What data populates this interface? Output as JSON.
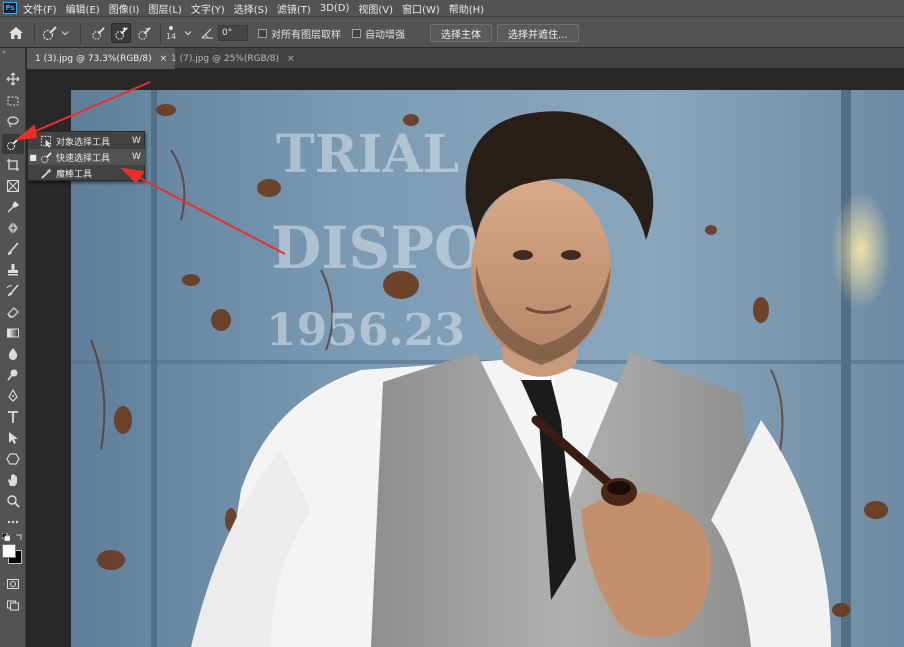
{
  "app": {
    "logo_text": "Ps"
  },
  "menu": [
    "文件(F)",
    "编辑(E)",
    "图像(I)",
    "图层(L)",
    "文字(Y)",
    "选择(S)",
    "滤镜(T)",
    "3D(D)",
    "视图(V)",
    "窗口(W)",
    "帮助(H)"
  ],
  "options": {
    "brush_size": "14",
    "angle_value": "0°",
    "sample_all_layers": "对所有图层取样",
    "auto_enhance": "自动增强",
    "select_subject": "选择主体",
    "select_and_mask": "选择并遮住..."
  },
  "tabs": [
    {
      "label": "1 (3).jpg @ 73.3%(RGB/8)",
      "close": "×"
    },
    {
      "label": "1 (7).jpg @ 25%(RGB/8)",
      "close": "×"
    }
  ],
  "flyout": {
    "items": [
      {
        "label": "对象选择工具",
        "shortcut": "W",
        "icon": "object-selection-icon"
      },
      {
        "label": "快速选择工具",
        "shortcut": "W",
        "icon": "quick-selection-icon",
        "bullet": "■"
      },
      {
        "label": "魔棒工具",
        "shortcut": "",
        "icon": "magic-wand-icon"
      }
    ]
  },
  "canvas": {
    "stencil_lines": [
      "TRIAL",
      "DISPO",
      "1956.23"
    ]
  },
  "colors": {
    "accent_arrow": "#e8302a",
    "foreground": "#ffffff",
    "background": "#000000"
  }
}
